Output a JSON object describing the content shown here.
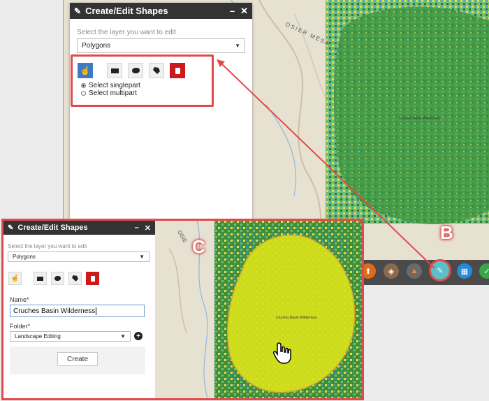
{
  "top_panel": {
    "title": "Create/Edit Shapes",
    "minimize_label": "–",
    "close_label": "✕",
    "layer_prompt": "Select the layer you want to edit",
    "layer_value": "Polygons",
    "radio_single": "Select singlepart",
    "radio_multi": "Select multipart",
    "selected_radio": "singlepart"
  },
  "map_labels": {
    "osier_mesa": "OSIER MESA",
    "polygon_label": "Cruches Basin Wilderness",
    "inset_fragment": "OSIE"
  },
  "badges": {
    "b": "B",
    "c": "C"
  },
  "toolbar": {
    "icons": [
      "upload-icon",
      "layers-icon",
      "fire-icon",
      "edit-shapes-icon",
      "grid-icon",
      "check-icon"
    ],
    "active": "edit-shapes-icon"
  },
  "inset_panel": {
    "title": "Create/Edit Shapes",
    "minimize_label": "–",
    "close_label": "✕",
    "layer_prompt": "Select the layer you want to edit",
    "layer_value": "Polygons",
    "name_label": "Name*",
    "name_value": "Cruches Basin Wilderness",
    "folder_label": "Folder*",
    "folder_value": "Landscape Editing",
    "add_folder_label": "+",
    "create_label": "Create"
  },
  "colors": {
    "highlight": "#e04a4a",
    "header": "#333333",
    "tool_blue": "#3d7cc4",
    "trash_red": "#cc1a1a",
    "polygon_fill": "#d8e21a"
  }
}
